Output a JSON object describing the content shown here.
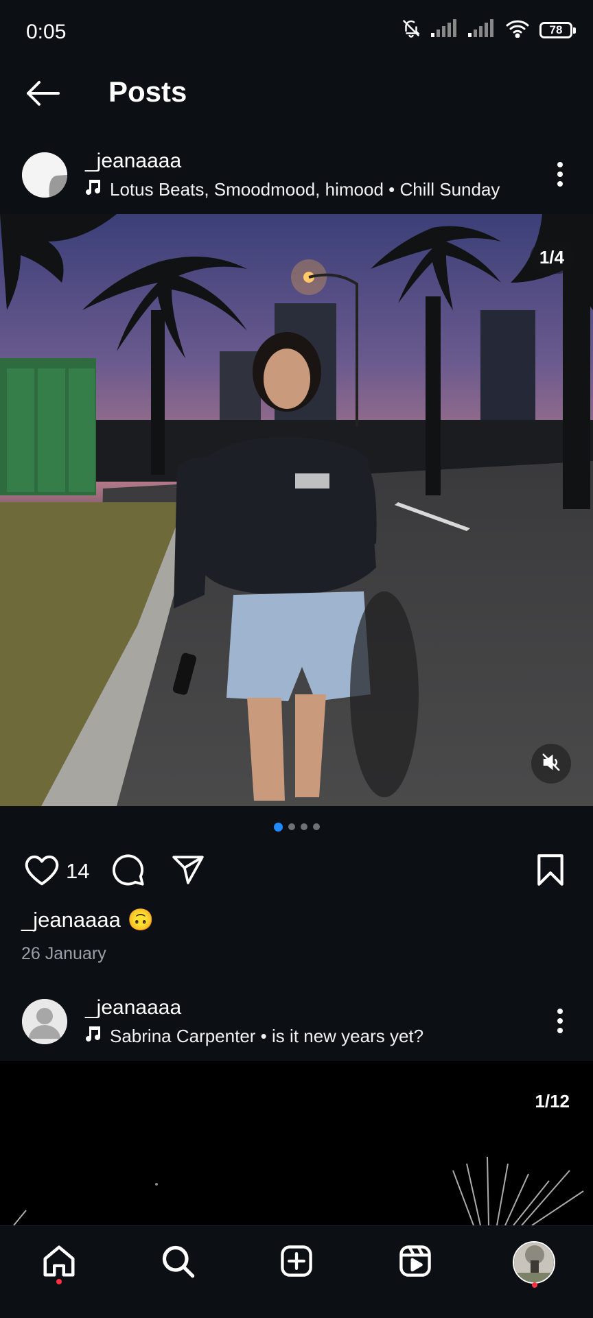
{
  "status_bar": {
    "time": "0:05",
    "battery": "78",
    "icons": [
      "bell-muted-icon",
      "signal-icon",
      "signal-icon",
      "wifi-icon",
      "battery-icon"
    ]
  },
  "header": {
    "title": "Posts",
    "back_icon": "arrow-left-icon"
  },
  "post1": {
    "username": "_jeanaaaa",
    "music": "Lotus Beats, Smoodmood, himood • Chill Sunday",
    "image_counter": "1/4",
    "likes": "14",
    "caption_user": "_jeanaaaa",
    "caption_emoji": "🙃",
    "date": "26 January",
    "carousel_total": 4,
    "carousel_active": 1
  },
  "post2": {
    "username": "_jeanaaaa",
    "music": "Sabrina Carpenter • is it new years yet?",
    "image_counter": "1/12"
  },
  "bottom_nav": {
    "items": [
      "home-icon",
      "search-icon",
      "create-icon",
      "reels-icon",
      "profile-avatar"
    ]
  },
  "colors": {
    "background": "#0c0f14",
    "accent_dot": "#1f8bff",
    "notification": "#ff3040"
  }
}
